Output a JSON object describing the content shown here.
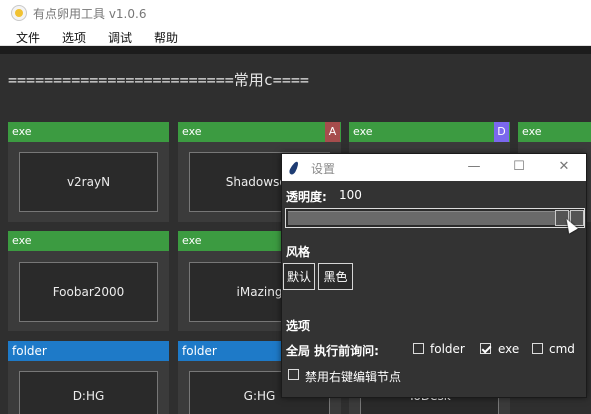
{
  "window": {
    "title": "有点卵用工具 v1.0.6"
  },
  "menu": [
    "文件",
    "选项",
    "调试",
    "帮助"
  ],
  "banner": "=========================常用c====",
  "rows": [
    {
      "cells": [
        {
          "tag": "exe",
          "name": "v2rayN",
          "hotkey": ""
        },
        {
          "tag": "exe",
          "name": "Shadowsoc",
          "hotkey": "A"
        },
        {
          "tag": "exe",
          "name": "",
          "hotkey": "D"
        },
        {
          "tag": "exe",
          "name": "",
          "hotkey": ""
        }
      ]
    },
    {
      "cells": [
        {
          "tag": "exe",
          "name": "Foobar2000",
          "hotkey": ""
        },
        {
          "tag": "exe",
          "name": "iMazing",
          "hotkey": ""
        }
      ]
    },
    {
      "cells": [
        {
          "tag": "folder",
          "name": "D:HG",
          "hotkey": ""
        },
        {
          "tag": "folder",
          "name": "G:HG",
          "hotkey": ""
        },
        {
          "tag": "",
          "name": "ToDesk",
          "hotkey": ""
        }
      ]
    }
  ],
  "colors": {
    "exe_tag": "#3c9b41",
    "folder_tag": "#1e7ac8",
    "hotkey_a": "#a64d4d",
    "hotkey_d": "#7b68ee"
  },
  "dialog": {
    "title": "设置",
    "minimize": "—",
    "maximize": "☐",
    "close": "✕",
    "opacity_label": "透明度:",
    "opacity_value": "100",
    "opacity_level": 1.0,
    "style_heading": "风格",
    "style_buttons": [
      "默认",
      "黑色"
    ],
    "options_heading": "选项",
    "global_confirm_label": "全局 执行前询问:",
    "checks": [
      {
        "label": "folder",
        "checked": false
      },
      {
        "label": "exe",
        "checked": true
      },
      {
        "label": "cmd",
        "checked": false
      }
    ],
    "disable_right_click": {
      "label": "禁用右键编辑节点",
      "checked": false
    }
  },
  "icons": {
    "app": "app-logo-icon",
    "dialog": "feather-icon"
  }
}
